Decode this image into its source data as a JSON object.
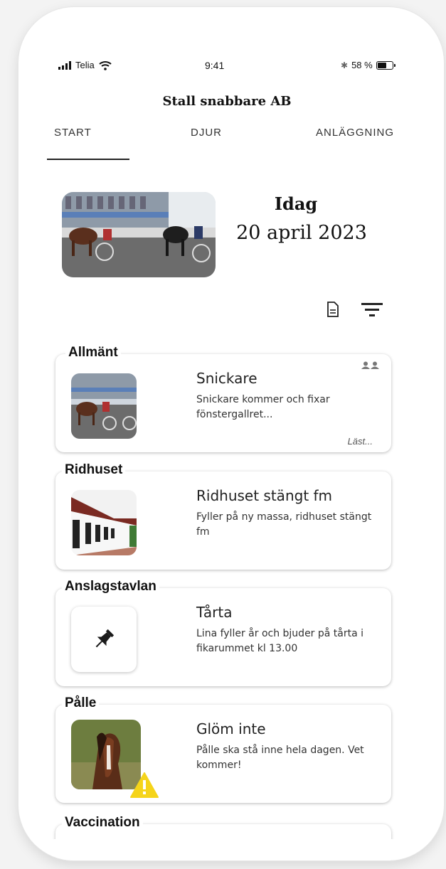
{
  "status_bar": {
    "carrier": "Telia",
    "time": "9:41",
    "battery": "58 %"
  },
  "header": {
    "title": "Stall snabbare AB"
  },
  "tabs": [
    {
      "label": "START"
    },
    {
      "label": "DJUR"
    },
    {
      "label": "ANLÄGGNING"
    }
  ],
  "today": {
    "label": "Idag",
    "date": "20 april 2023"
  },
  "toolbar": {
    "document_icon": "document-icon",
    "filter_icon": "filter-icon"
  },
  "cards": [
    {
      "category": "Allmänt",
      "title": "Snickare",
      "body": "Snickare kommer och fixar fönstergallret...",
      "more": "Läst..."
    },
    {
      "category": "Ridhuset",
      "title": "Ridhuset stängt fm",
      "body": "Fyller på ny massa, ridhuset stängt fm"
    },
    {
      "category": "Anslagstavlan",
      "title": "Tårta",
      "body": "Lina fyller år och bjuder på tårta i fikarummet kl 13.00"
    },
    {
      "category": "Pålle",
      "title": "Glöm inte",
      "body": "Pålle ska stå inne hela dagen. Vet kommer!"
    },
    {
      "category": "Vaccination"
    }
  ],
  "colors": {
    "warning": "#f5d41a",
    "text": "#222222"
  }
}
